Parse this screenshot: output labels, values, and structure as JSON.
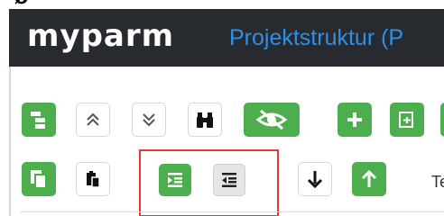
{
  "header": {
    "logo_text": "myparm",
    "title": "Projektstruktur (P"
  },
  "toolbar": {
    "row1": [
      "tree-structure",
      "collapse-up",
      "expand-down",
      "binoculars-search",
      "hide-visibility",
      "add",
      "new-folder"
    ],
    "row2": [
      "copy",
      "paste",
      "indent",
      "outdent",
      "move-down",
      "move-up"
    ],
    "partial_label": "Te"
  },
  "colors": {
    "header_bg": "#272a2e",
    "title_blue": "#2f8fe8",
    "button_green": "#4cae4c",
    "highlight_red": "#e53935"
  }
}
